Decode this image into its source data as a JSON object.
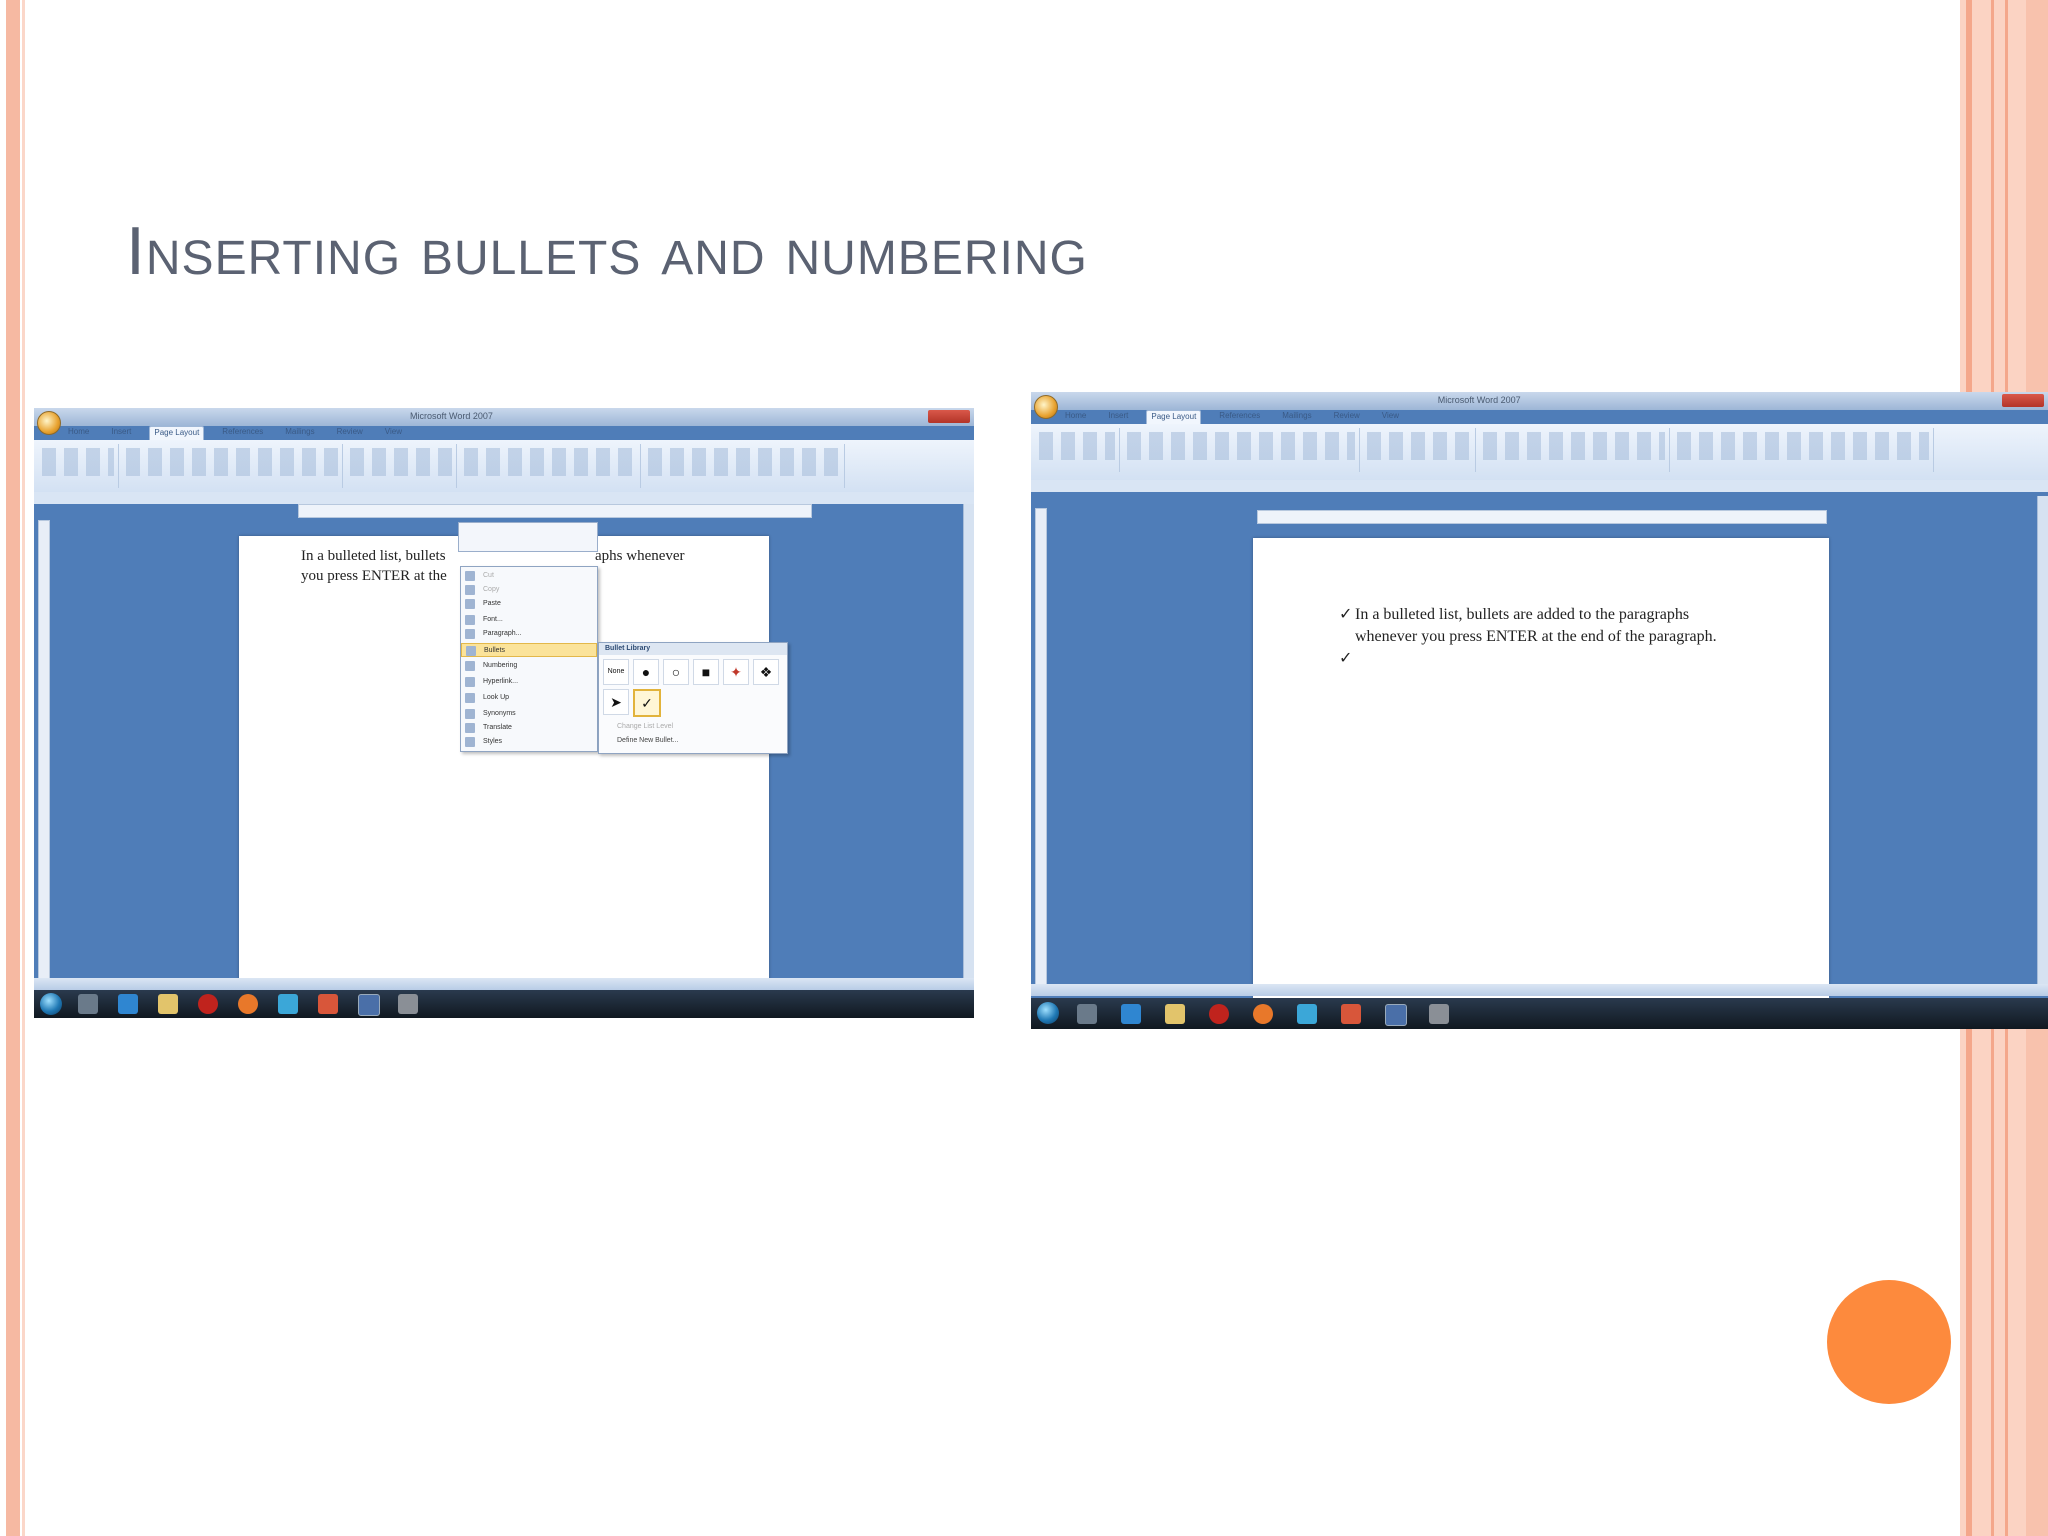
{
  "slide": {
    "title": "Inserting bullets and numbering"
  },
  "colors": {
    "title_text": "#5b6272",
    "accent_orange": "#fd8a3d",
    "stripe_salmon": "#f4a78b",
    "word_blue": "#4f7db8"
  },
  "screenshot_left": {
    "app": "Microsoft Word 2007",
    "ribbon_tabs": [
      "Home",
      "Insert",
      "Page Layout",
      "References",
      "Mailings",
      "Review",
      "View"
    ],
    "active_tab": "Page Layout",
    "document_text_line1a": "In a bulleted list, bullets",
    "document_text_line1b": "aphs whenever",
    "document_text_line2": "you press ENTER at the",
    "context_menu": {
      "items": [
        "Cut",
        "Copy",
        "Paste",
        "Font...",
        "Paragraph...",
        "Bullets",
        "Numbering",
        "Hyperlink...",
        "Look Up",
        "Synonyms",
        "Translate",
        "Styles"
      ],
      "highlighted": "Bullets"
    },
    "bullet_library": {
      "title": "Bullet Library",
      "none_label": "None",
      "bullets": [
        "●",
        "○",
        "■",
        "✦",
        "❖",
        "➤",
        "✓"
      ],
      "selected": "✓",
      "links": [
        "Change List Level",
        "Define New Bullet..."
      ]
    }
  },
  "screenshot_right": {
    "app": "Microsoft Word 2007",
    "ribbon_tabs": [
      "Home",
      "Insert",
      "Page Layout",
      "References",
      "Mailings",
      "Review",
      "View"
    ],
    "active_tab": "Page Layout",
    "bullet_mark": "✓",
    "document_text_line1": "In a bulleted list, bullets are added to the paragraphs",
    "document_text_line2": "whenever you press ENTER at the end of the paragraph."
  }
}
